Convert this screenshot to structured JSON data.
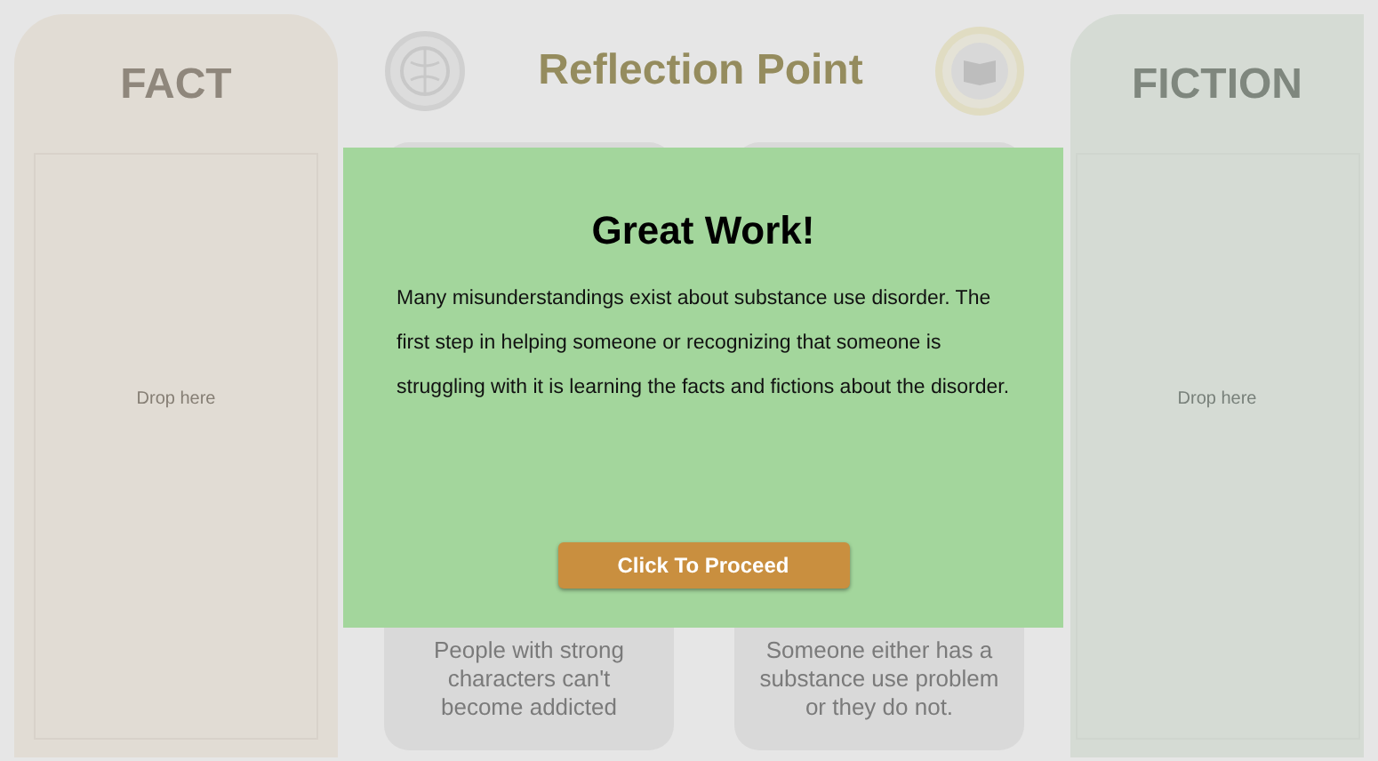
{
  "fact_panel": {
    "title": "FACT",
    "drop_hint": "Drop here"
  },
  "header": {
    "title": "Reflection Point"
  },
  "cards": [
    {
      "text": "People with strong characters can't become addicted"
    },
    {
      "text": "Someone either has a substance use problem or they do not."
    }
  ],
  "fiction_panel": {
    "title": "FICTION",
    "drop_hint": "Drop here"
  },
  "dialog": {
    "title": "Great Work!",
    "message": "Many misunderstandings exist about substance use disorder. The first step in helping someone or recognizing that someone is struggling with it is learning the facts and fictions about the disorder.",
    "button": "Click To Proceed"
  }
}
